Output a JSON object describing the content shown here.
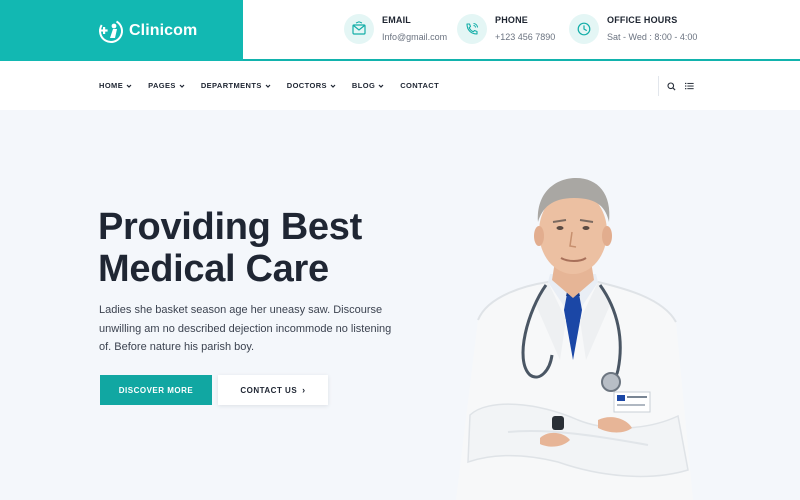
{
  "brand": {
    "name": "Clinicom",
    "color": "#12b8b2"
  },
  "contacts": [
    {
      "icon": "mail-icon",
      "title": "EMAIL",
      "value": "Info@gmail.com"
    },
    {
      "icon": "phone-icon",
      "title": "PHONE",
      "value": "+123 456 7890"
    },
    {
      "icon": "clock-icon",
      "title": "OFFICE HOURS",
      "value": "Sat - Wed : 8:00 - 4:00"
    }
  ],
  "nav": {
    "items": [
      {
        "label": "HOME",
        "dropdown": true
      },
      {
        "label": "PAGES",
        "dropdown": true
      },
      {
        "label": "DEPARTMENTS",
        "dropdown": true
      },
      {
        "label": "DOCTORS",
        "dropdown": true
      },
      {
        "label": "BLOG",
        "dropdown": true
      },
      {
        "label": "CONTACT",
        "dropdown": false
      }
    ],
    "tools": [
      "search-icon",
      "menu-list-icon"
    ]
  },
  "hero": {
    "title_line1": "Providing Best",
    "title_line2": "Medical Care",
    "description": "Ladies she basket season age her uneasy saw. Discourse unwilling am no described dejection incommode no listening of. Before nature his parish boy.",
    "primary_button": "DISCOVER MORE",
    "secondary_button": "CONTACT US",
    "secondary_button_arrow": "›"
  },
  "colors": {
    "accent": "#12b3ad",
    "hero_bg": "#f4f7fb",
    "heading": "#1f2633"
  }
}
